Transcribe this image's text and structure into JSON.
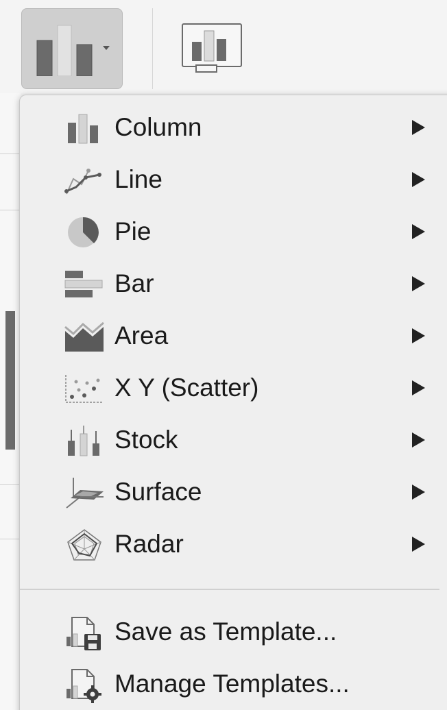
{
  "toolbar": {
    "chart_button_icon": "column-chart-icon",
    "recommended_button_icon": "recommended-charts-icon"
  },
  "menu": {
    "chart_types": [
      {
        "label": "Column",
        "icon": "column-chart-icon"
      },
      {
        "label": "Line",
        "icon": "line-chart-icon"
      },
      {
        "label": "Pie",
        "icon": "pie-chart-icon"
      },
      {
        "label": "Bar",
        "icon": "bar-chart-icon"
      },
      {
        "label": "Area",
        "icon": "area-chart-icon"
      },
      {
        "label": "X Y (Scatter)",
        "icon": "scatter-chart-icon"
      },
      {
        "label": "Stock",
        "icon": "stock-chart-icon"
      },
      {
        "label": "Surface",
        "icon": "surface-chart-icon"
      },
      {
        "label": "Radar",
        "icon": "radar-chart-icon"
      }
    ],
    "templates": [
      {
        "label": "Save as Template...",
        "icon": "save-template-icon"
      },
      {
        "label": "Manage Templates...",
        "icon": "manage-templates-icon"
      }
    ]
  },
  "colors": {
    "menu_bg": "#efefef",
    "icon_dark": "#6a6a6a",
    "icon_light": "#c4c4c4",
    "text": "#1a1a1a"
  }
}
